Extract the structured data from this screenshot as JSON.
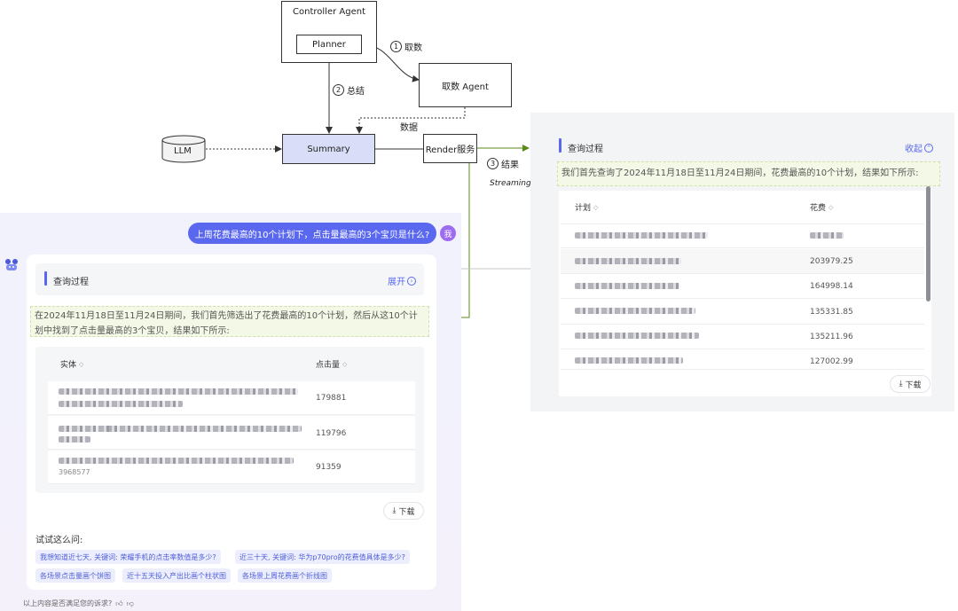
{
  "diagram": {
    "controller_agent": "Controller Agent",
    "planner": "Planner",
    "fetch_agent": "取数 Agent",
    "llm": "LLM",
    "summary": "Summary",
    "render_service": "Render服务",
    "edge_fetch": {
      "num": "1",
      "label": "取数"
    },
    "edge_summarize": {
      "num": "2",
      "label": "总结"
    },
    "edge_data": "数据",
    "edge_result": {
      "num": "3",
      "label": "结果"
    },
    "streaming": "Streaming"
  },
  "chat": {
    "user_question": "上周花费最高的10个计划下，点击量最高的3个宝贝是什么?",
    "user_avatar": "我",
    "process_title": "查询过程",
    "expand_label": "展开",
    "answer_text": "在2024年11月18日至11月24日期间，我们首先筛选出了花费最高的10个计划，然后从这10个计划中找到了点击量最高的3个宝贝，结果如下所示:",
    "table": {
      "headers": [
        "实体",
        "点击量"
      ],
      "rows": [
        {
          "value": "179881"
        },
        {
          "value": "119796"
        },
        {
          "value": "91359",
          "entity_tail": "3968577"
        }
      ]
    },
    "download_label": "下载",
    "try_label": "试试这么问:",
    "suggestions": [
      "我想知道近七天, 关键词: 荣耀手机的点击率数值是多少?",
      "近三十天, 关键词: 华为p70pro的花费值具体是多少?",
      "各场景点击量画个饼图",
      "近十五天投入产出比画个柱状图",
      "各场景上周花费画个折线图"
    ],
    "feedback": "以上内容是否满足您的诉求?"
  },
  "expanded": {
    "process_title": "查询过程",
    "collapse_label": "收起",
    "answer_text": "我们首先查询了2024年11月18日至11月24日期间，花费最高的10个计划，结果如下所示:",
    "table": {
      "headers": [
        "计划",
        "花费"
      ],
      "rows": [
        {
          "value": ""
        },
        {
          "value": "203979.25"
        },
        {
          "value": "164998.14"
        },
        {
          "value": "135331.85"
        },
        {
          "value": "135211.96"
        },
        {
          "value": "127002.99"
        }
      ]
    },
    "download_label": "下载"
  },
  "colors": {
    "accent": "#5968ef",
    "summary_fill": "#d9ddf8",
    "arrow_green": "#5a8a1a",
    "highlight_bg": "#f3f9e6"
  }
}
